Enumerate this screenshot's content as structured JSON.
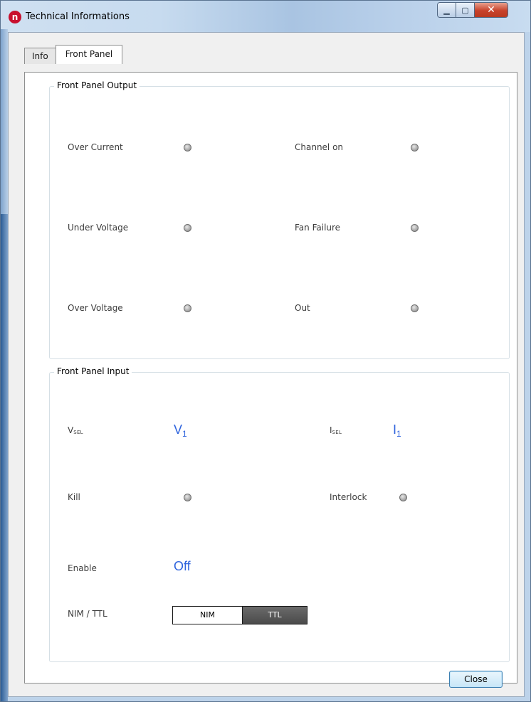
{
  "window": {
    "title": "Technical Informations",
    "icon_letter": "n",
    "minimize_glyph": "▁",
    "maximize_glyph": "▢",
    "close_glyph": "✕"
  },
  "tabs": [
    {
      "label": "Info",
      "active": false
    },
    {
      "label": "Front Panel",
      "active": true
    }
  ],
  "output_group": {
    "title": "Front Panel Output",
    "indicators": [
      {
        "label": "Over Current",
        "state": "off"
      },
      {
        "label": "Channel on",
        "state": "off"
      },
      {
        "label": "Under Voltage",
        "state": "off"
      },
      {
        "label": "Fan Failure",
        "state": "off"
      },
      {
        "label": "Over Voltage",
        "state": "off"
      },
      {
        "label": "Out",
        "state": "off"
      }
    ]
  },
  "input_group": {
    "title": "Front Panel Input",
    "vsel": {
      "label_main": "V",
      "label_sub": "SEL",
      "value_main": "V",
      "value_sub": "1"
    },
    "isel": {
      "label_main": "I",
      "label_sub": "SEL",
      "value_main": "I",
      "value_sub": "1"
    },
    "kill": {
      "label": "Kill",
      "state": "off"
    },
    "interlock": {
      "label": "Interlock",
      "state": "off"
    },
    "enable": {
      "label": "Enable",
      "value": "Off"
    },
    "nim_ttl": {
      "label": "NIM / TTL",
      "options": [
        "NIM",
        "TTL"
      ],
      "selected": "TTL"
    }
  },
  "footer": {
    "close_label": "Close"
  },
  "colors": {
    "value_blue": "#2f64dd",
    "led_off": "#9a9a9a"
  }
}
